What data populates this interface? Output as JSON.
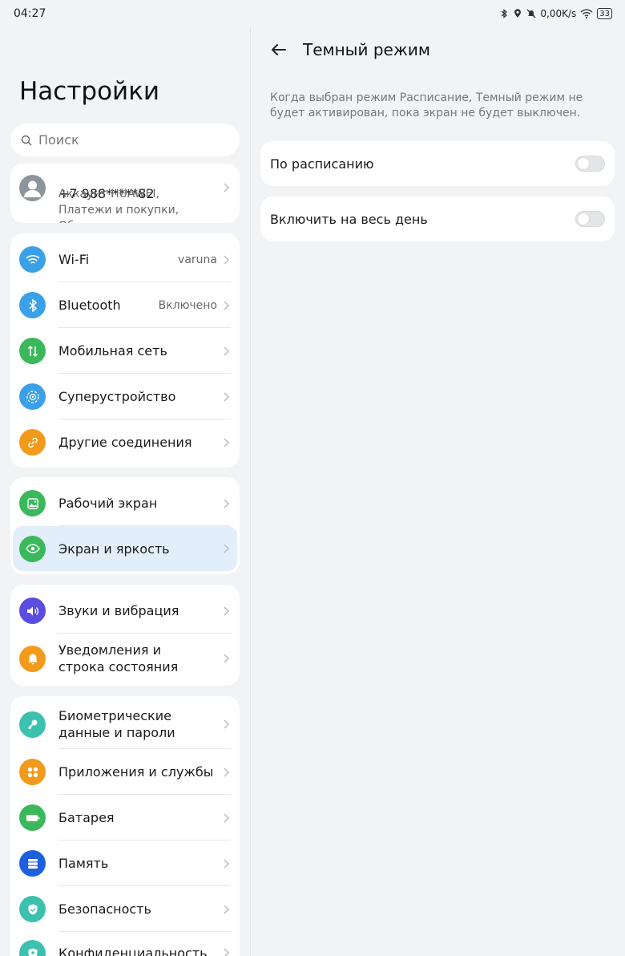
{
  "status_bar": {
    "time": "04:27",
    "net_speed": "0,00K/s",
    "battery": "33",
    "icons": [
      "bluetooth-icon",
      "location-icon",
      "mute-icon",
      "wifi-icon",
      "battery-icon"
    ]
  },
  "sidebar": {
    "title": "Настройки",
    "search_placeholder": "Поиск",
    "account": {
      "phone": "+7 988*****82",
      "subtitle": "Аккаунт HUAWEI, Платежи и покупки, Облако и прочее"
    },
    "group1": [
      {
        "label": "Wi-Fi",
        "value": "varuna",
        "color": "#3aa0e8",
        "icon": "wifi-icon"
      },
      {
        "label": "Bluetooth",
        "value": "Включено",
        "color": "#3aa0e8",
        "icon": "bluetooth-icon"
      },
      {
        "label": "Мобильная сеть",
        "value": "",
        "color": "#3bb85c",
        "icon": "mobile-data-icon"
      },
      {
        "label": "Суперустройство",
        "value": "",
        "color": "#3aa0e8",
        "icon": "superdevice-icon"
      },
      {
        "label": "Другие соединения",
        "value": "",
        "color": "#f29a1c",
        "icon": "link-icon"
      }
    ],
    "group2": [
      {
        "label": "Рабочий экран",
        "color": "#3bb85c",
        "icon": "wallpaper-icon"
      },
      {
        "label": "Экран и яркость",
        "color": "#3bb85c",
        "icon": "eye-icon",
        "selected": true
      }
    ],
    "group3": [
      {
        "label": "Звуки и вибрация",
        "color": "#5b4de0",
        "icon": "sound-icon"
      },
      {
        "label": "Уведомления и строка состояния",
        "color": "#f29a1c",
        "icon": "bell-icon"
      }
    ],
    "group4": [
      {
        "label": "Биометрические данные и пароли",
        "color": "#3cc1ae",
        "icon": "key-icon"
      },
      {
        "label": "Приложения и службы",
        "color": "#f29a1c",
        "icon": "apps-icon"
      },
      {
        "label": "Батарея",
        "color": "#3bb85c",
        "icon": "battery-icon"
      },
      {
        "label": "Память",
        "color": "#1e5fe0",
        "icon": "storage-icon"
      },
      {
        "label": "Безопасность",
        "color": "#3cc1ae",
        "icon": "shield-icon"
      },
      {
        "label": "Конфиденциальность",
        "color": "#3cc1ae",
        "icon": "privacy-icon"
      }
    ]
  },
  "detail": {
    "title": "Темный режим",
    "note": "Когда выбран режим Расписание, Темный режим не будет активирован, пока экран не будет выключен.",
    "options": [
      {
        "label": "По расписанию",
        "on": false
      },
      {
        "label": "Включить на весь день",
        "on": false
      }
    ]
  }
}
